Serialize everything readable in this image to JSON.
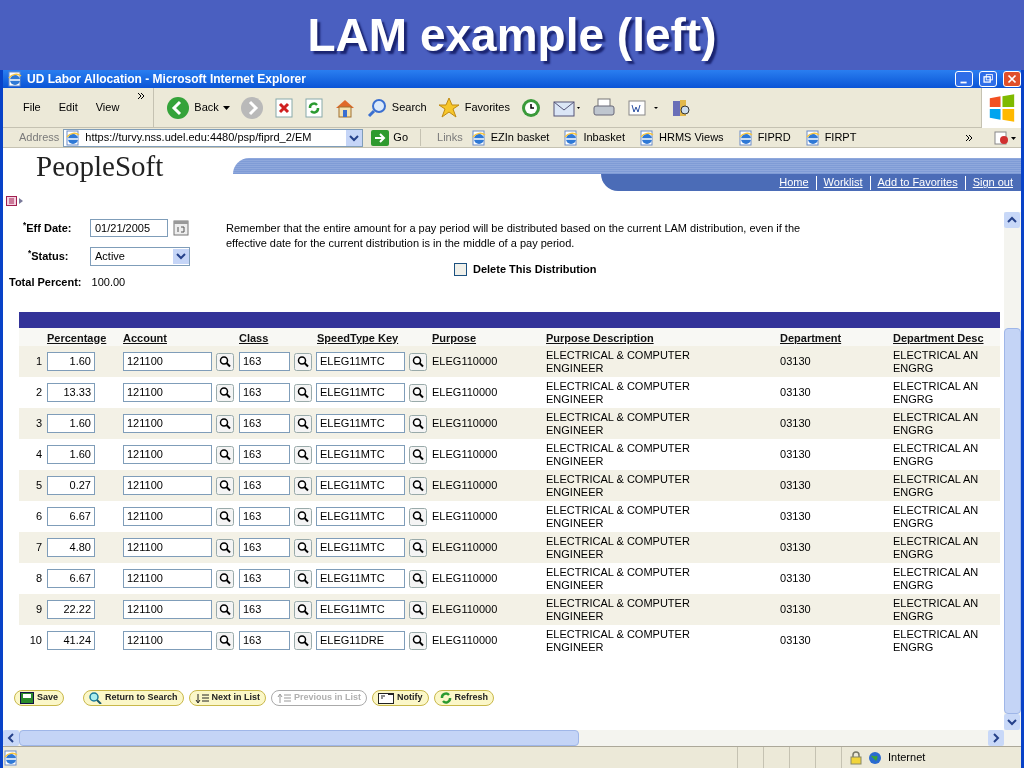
{
  "slide_title": "LAM example (left)",
  "window": {
    "title": "UD Labor Allocation - Microsoft Internet Explorer"
  },
  "menu": [
    "File",
    "Edit",
    "View"
  ],
  "toolbar": [
    {
      "kind": "back",
      "label": "Back"
    },
    {
      "kind": "forward"
    },
    {
      "kind": "stop"
    },
    {
      "kind": "refresh"
    },
    {
      "kind": "home"
    },
    {
      "kind": "search",
      "label": "Search"
    },
    {
      "kind": "favorites",
      "label": "Favorites"
    },
    {
      "kind": "history"
    },
    {
      "kind": "mail"
    },
    {
      "kind": "print"
    },
    {
      "kind": "word"
    },
    {
      "kind": "research"
    }
  ],
  "address": {
    "label": "Address",
    "url": "https://turvy.nss.udel.edu:4480/psp/fiprd_2/EM",
    "go": "Go"
  },
  "links": {
    "label": "Links",
    "items": [
      "EZIn basket",
      "Inbasket",
      "HRMS Views",
      "FIPRD",
      "FIRPT"
    ]
  },
  "header": {
    "logo": "PeopleSoft",
    "nav": [
      "Home",
      "Worklist",
      "Add to Favorites",
      "Sign out"
    ]
  },
  "form": {
    "eff_date_label": "$^{*}$Eff Date:",
    "eff_date": "01/21/2005",
    "status_label": "$^{*}$Status:",
    "status": "Active",
    "notice": "Remember that the entire amount for a pay period will be distributed based on the current LAM distribution, even if the effective date for the current distribution is in the middle of a pay period.",
    "delete": {
      "label": "Delete This Distribution",
      "checked": false
    },
    "total_label": "Total Percent:",
    "total": "100.00"
  },
  "table": {
    "columns": [
      "Percentage",
      "Account",
      "Class",
      "SpeedType Key",
      "Purpose",
      "Purpose Description",
      "Department",
      "Department Desc"
    ],
    "rows": [
      {
        "num": "1",
        "percentage": "1.60",
        "account": "121100",
        "class": "163",
        "speedtype": "ELEG11MTC",
        "purpose": "ELEG110000",
        "purpose_description": "ELECTRICAL & COMPUTER ENGINEER",
        "department": "03130",
        "department_description": "ELECTRICAL AN ENGRG"
      },
      {
        "num": "2",
        "percentage": "13.33",
        "account": "121100",
        "class": "163",
        "speedtype": "ELEG11MTC",
        "purpose": "ELEG110000",
        "purpose_description": "ELECTRICAL & COMPUTER ENGINEER",
        "department": "03130",
        "department_description": "ELECTRICAL AN ENGRG"
      },
      {
        "num": "3",
        "percentage": "1.60",
        "account": "121100",
        "class": "163",
        "speedtype": "ELEG11MTC",
        "purpose": "ELEG110000",
        "purpose_description": "ELECTRICAL & COMPUTER ENGINEER",
        "department": "03130",
        "department_description": "ELECTRICAL AN ENGRG"
      },
      {
        "num": "4",
        "percentage": "1.60",
        "account": "121100",
        "class": "163",
        "speedtype": "ELEG11MTC",
        "purpose": "ELEG110000",
        "purpose_description": "ELECTRICAL & COMPUTER ENGINEER",
        "department": "03130",
        "department_description": "ELECTRICAL AN ENGRG"
      },
      {
        "num": "5",
        "percentage": "0.27",
        "account": "121100",
        "class": "163",
        "speedtype": "ELEG11MTC",
        "purpose": "ELEG110000",
        "purpose_description": "ELECTRICAL & COMPUTER ENGINEER",
        "department": "03130",
        "department_description": "ELECTRICAL AN ENGRG"
      },
      {
        "num": "6",
        "percentage": "6.67",
        "account": "121100",
        "class": "163",
        "speedtype": "ELEG11MTC",
        "purpose": "ELEG110000",
        "purpose_description": "ELECTRICAL & COMPUTER ENGINEER",
        "department": "03130",
        "department_description": "ELECTRICAL AN ENGRG"
      },
      {
        "num": "7",
        "percentage": "4.80",
        "account": "121100",
        "class": "163",
        "speedtype": "ELEG11MTC",
        "purpose": "ELEG110000",
        "purpose_description": "ELECTRICAL & COMPUTER ENGINEER",
        "department": "03130",
        "department_description": "ELECTRICAL AN ENGRG"
      },
      {
        "num": "8",
        "percentage": "6.67",
        "account": "121100",
        "class": "163",
        "speedtype": "ELEG11MTC",
        "purpose": "ELEG110000",
        "purpose_description": "ELECTRICAL & COMPUTER ENGINEER",
        "department": "03130",
        "department_description": "ELECTRICAL AN ENGRG"
      },
      {
        "num": "9",
        "percentage": "22.22",
        "account": "121100",
        "class": "163",
        "speedtype": "ELEG11MTC",
        "purpose": "ELEG110000",
        "purpose_description": "ELECTRICAL & COMPUTER ENGINEER",
        "department": "03130",
        "department_description": "ELECTRICAL AN ENGRG"
      },
      {
        "num": "10",
        "percentage": "41.24",
        "account": "121100",
        "class": "163",
        "speedtype": "ELEG11DRE",
        "purpose": "ELEG110000",
        "purpose_description": "ELECTRICAL & COMPUTER ENGINEER",
        "department": "03130",
        "department_description": "ELECTRICAL AN ENGRG"
      }
    ]
  },
  "buttons": [
    {
      "kind": "save",
      "label": "Save",
      "disabled": false
    },
    {
      "kind": "return",
      "label": "Return to Search",
      "disabled": false
    },
    {
      "kind": "next",
      "label": "Next in List",
      "disabled": false
    },
    {
      "kind": "previous",
      "label": "Previous in List",
      "disabled": true
    },
    {
      "kind": "notify",
      "label": "Notify",
      "disabled": false
    },
    {
      "kind": "refresh",
      "label": "Refresh",
      "disabled": false
    }
  ],
  "status_bar": {
    "zone": "Internet"
  }
}
